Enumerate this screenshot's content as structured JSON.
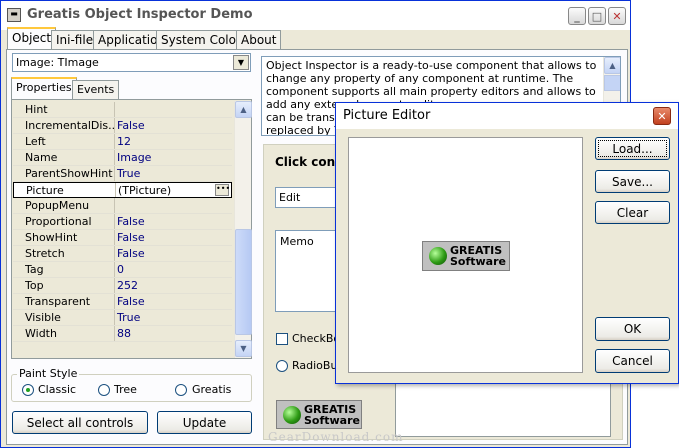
{
  "main_window": {
    "title": "Greatis Object Inspector Demo",
    "tabs": [
      "Object",
      "Ini-file",
      "Application",
      "System Colors",
      "About"
    ],
    "object_combo_value": "Image: TImage",
    "inspector_tabs": [
      "Properties",
      "Events"
    ],
    "properties": [
      {
        "name": "Hint",
        "value": ""
      },
      {
        "name": "IncrementalDis...",
        "value": "False"
      },
      {
        "name": "Left",
        "value": "12"
      },
      {
        "name": "Name",
        "value": "Image"
      },
      {
        "name": "ParentShowHint",
        "value": "True"
      },
      {
        "name": "Picture",
        "value": "(TPicture)"
      },
      {
        "name": "PopupMenu",
        "value": ""
      },
      {
        "name": "Proportional",
        "value": "False"
      },
      {
        "name": "ShowHint",
        "value": "False"
      },
      {
        "name": "Stretch",
        "value": "False"
      },
      {
        "name": "Tag",
        "value": "0"
      },
      {
        "name": "Top",
        "value": "252"
      },
      {
        "name": "Transparent",
        "value": "False"
      },
      {
        "name": "Visible",
        "value": "True"
      },
      {
        "name": "Width",
        "value": "88"
      }
    ],
    "paint_style": {
      "label": "Paint Style",
      "options": [
        "Classic",
        "Tree",
        "Greatis"
      ],
      "selected": "Classic"
    },
    "select_all_label": "Select all controls",
    "update_label": "Update",
    "description": "Object Inspector is a ready-to-use component that allows to change any property of any component at runtime. The component supports all main property editors and allows to add  any external property editor",
    "description_hidden_line_1": "can be translat",
    "description_hidden_line_2": "replaced by Ye",
    "click_controls_label": "Click contro",
    "edit_value": "Edit",
    "memo_value": "Memo",
    "checkbox_label": "CheckBox",
    "radio_label": "RadioBut",
    "logo_line1": "GREATIS",
    "logo_line2": "Software"
  },
  "picture_editor": {
    "title": "Picture Editor",
    "load_label": "Load...",
    "save_label": "Save...",
    "clear_label": "Clear",
    "ok_label": "OK",
    "cancel_label": "Cancel",
    "logo_line1": "GREATIS",
    "logo_line2": "Software"
  },
  "watermark": "GearDownload.com"
}
